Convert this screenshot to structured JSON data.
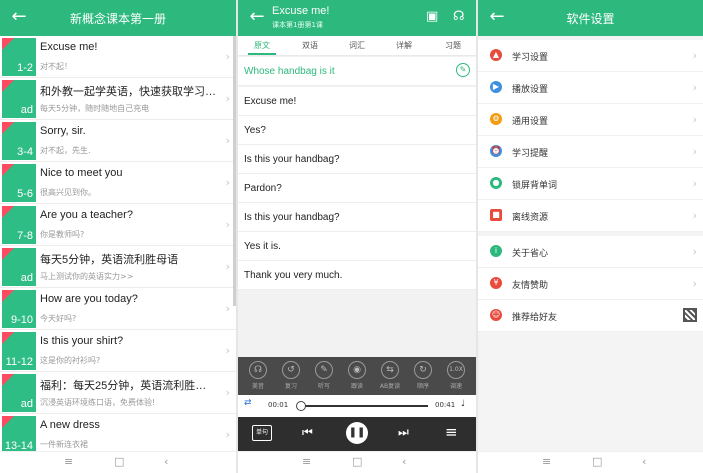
{
  "panel1": {
    "title": "新概念课本第一册",
    "lessons": [
      {
        "title": "Excuse me!",
        "subtitle": "对不起！",
        "badge": "1-2"
      },
      {
        "title": "和外教一起学英语，快速获取学习的…",
        "subtitle": "每天5分钟，随时随地自己充电",
        "badge": "ad"
      },
      {
        "title": "Sorry, sir.",
        "subtitle": "对不起，先生.",
        "badge": "3-4"
      },
      {
        "title": "Nice to meet you",
        "subtitle": "很高兴见到你。",
        "badge": "5-6"
      },
      {
        "title": "Are you a teacher?",
        "subtitle": "你是教师吗?",
        "badge": "7-8"
      },
      {
        "title": "每天5分钟，英语流利胜母语",
        "subtitle": "马上测试你的英语实力>>",
        "badge": "ad"
      },
      {
        "title": "How are you today?",
        "subtitle": "今天好吗?",
        "badge": "9-10"
      },
      {
        "title": "Is this your shirt?",
        "subtitle": "这是你的衬衫吗?",
        "badge": "11-12"
      },
      {
        "title": "福利：每天25分钟，英语流利胜母语.👄",
        "subtitle": "沉浸英语环境练口语，免费体验!",
        "badge": "ad"
      },
      {
        "title": "A new dress",
        "subtitle": "一件新连衣裙",
        "badge": "13-14"
      }
    ]
  },
  "panel2": {
    "title": "Excuse me!",
    "subtitle": "课本第1册第1课",
    "tabs": [
      "原文",
      "双语",
      "词汇",
      "详解",
      "习题"
    ],
    "lines": [
      "Whose handbag is it",
      "Excuse me!",
      "Yes?",
      "Is this your handbag?",
      "Pardon?",
      "Is this your handbag?",
      "Yes it is.",
      "Thank you very much."
    ],
    "tools": [
      "美音",
      "复习",
      "听写",
      "跟读",
      "AB复读",
      "顺序",
      "调速"
    ],
    "speed": "1.0X",
    "repeat_label": "单句",
    "time_current": "00:01",
    "time_total": "00:41",
    "progress_fraction": 0.0
  },
  "panel3": {
    "title": "软件设置",
    "group1": [
      {
        "label": "学习设置",
        "icon": "graduation-cap-icon",
        "color": "#e84a3c"
      },
      {
        "label": "播放设置",
        "icon": "play-circle-icon",
        "color": "#3d8fe0"
      },
      {
        "label": "通用设置",
        "icon": "gear-icon",
        "color": "#f39c12"
      },
      {
        "label": "学习提醒",
        "icon": "alarm-icon",
        "color": "#3d8fe0"
      },
      {
        "label": "锁屏背单词",
        "icon": "lock-icon",
        "color": "#2db87d"
      },
      {
        "label": "离线资源",
        "icon": "book-icon",
        "color": "#e84a3c"
      }
    ],
    "group2": [
      {
        "label": "关于省心",
        "icon": "info-icon",
        "color": "#2db87d"
      },
      {
        "label": "友情赞助",
        "icon": "yen-icon",
        "color": "#e84a3c"
      },
      {
        "label": "推荐给好友",
        "icon": "share-person-icon",
        "color": "#e84a3c"
      }
    ]
  }
}
